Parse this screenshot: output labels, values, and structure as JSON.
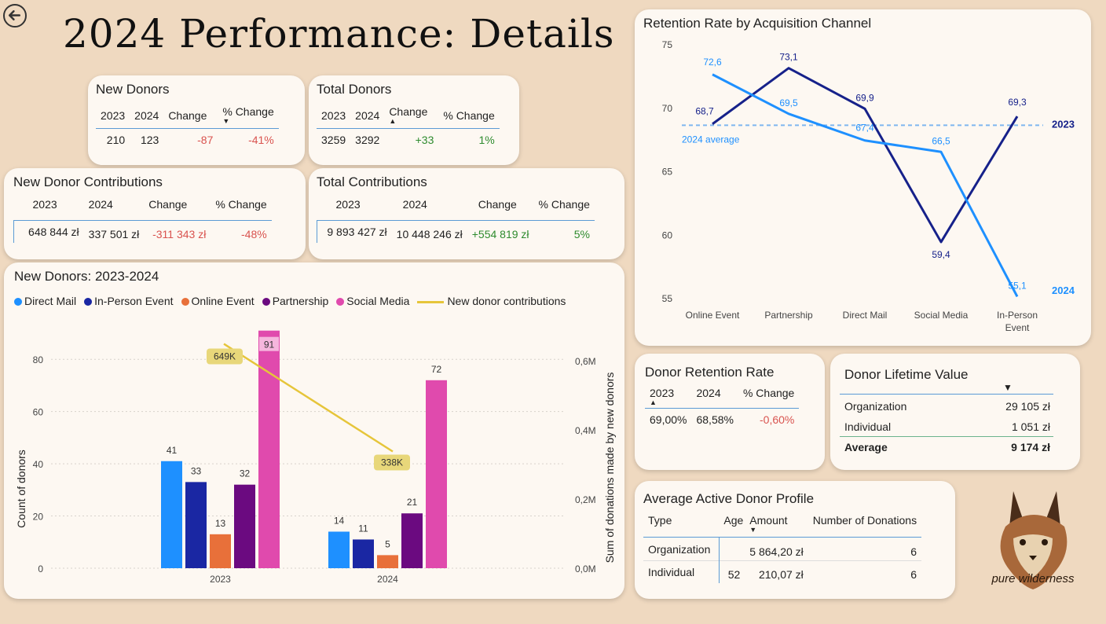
{
  "page": {
    "title": "2024 Performance: Details"
  },
  "new_donors": {
    "title": "New Donors",
    "headers": [
      "2023",
      "2024",
      "Change",
      "% Change"
    ],
    "row": [
      "210",
      "123",
      "-87",
      "-41%"
    ]
  },
  "total_donors": {
    "title": "Total Donors",
    "headers": [
      "2023",
      "2024",
      "Change",
      "% Change"
    ],
    "row": [
      "3259",
      "3292",
      "+33",
      "1%"
    ]
  },
  "new_donor_contrib": {
    "title": "New Donor Contributions",
    "headers": [
      "2023",
      "2024",
      "Change",
      "% Change"
    ],
    "row": [
      "648 844 zł",
      "337 501 zł",
      "-311 343 zł",
      "-48%"
    ]
  },
  "total_contrib": {
    "title": "Total Contributions",
    "headers": [
      "2023",
      "2024",
      "Change",
      "% Change"
    ],
    "row": [
      "9 893 427 zł",
      "10 448 246 zł",
      "+554 819 zł",
      "5%"
    ]
  },
  "bar_chart": {
    "title": "New Donors: 2023-2024",
    "legend": [
      {
        "name": "Direct Mail",
        "color": "#1e90ff"
      },
      {
        "name": "In-Person Event",
        "color": "#1a27a3"
      },
      {
        "name": "Online Event",
        "color": "#e8703a"
      },
      {
        "name": "Partnership",
        "color": "#6b0a80"
      },
      {
        "name": "Social Media",
        "color": "#e04aad"
      },
      {
        "name": "New donor contributions",
        "color": "#e6c53a"
      }
    ],
    "ylabel_left": "Count of donors",
    "ylabel_right": "Sum of donations made by new donors",
    "left_ticks": [
      "0",
      "20",
      "40",
      "60",
      "80"
    ],
    "right_ticks": [
      "0,0M",
      "0,2M",
      "0,4M",
      "0,6M"
    ]
  },
  "line_chart_title": "Retention Rate by Acquisition Channel",
  "line_chart_avg_label": "2024 average",
  "line_chart_ticks": [
    "55",
    "60",
    "65",
    "70",
    "75"
  ],
  "retention": {
    "title": "Donor Retention Rate",
    "headers": [
      "2023",
      "2024",
      "% Change"
    ],
    "row": [
      "69,00%",
      "68,58%",
      "-0,60%"
    ]
  },
  "lifetime": {
    "title": "Donor Lifetime Value",
    "rows": [
      {
        "label": "Organization",
        "value": "29 105 zł"
      },
      {
        "label": "Individual",
        "value": "1 051 zł"
      },
      {
        "label": "Average",
        "value": "9 174 zł"
      }
    ]
  },
  "profile": {
    "title": "Average Active Donor Profile",
    "headers": [
      "Type",
      "Age",
      "Amount",
      "Number of Donations"
    ],
    "rows": [
      [
        "Organization",
        "",
        "5 864,20 zł",
        "6"
      ],
      [
        "Individual",
        "52",
        "210,07 zł",
        "6"
      ]
    ]
  },
  "logo_text": "pure wilderness",
  "chart_data": [
    {
      "type": "bar",
      "title": "New Donors: 2023-2024",
      "categories": [
        "2023",
        "2024"
      ],
      "series": [
        {
          "name": "Direct Mail",
          "values": [
            41,
            14
          ],
          "color": "#1e90ff"
        },
        {
          "name": "In-Person Event",
          "values": [
            33,
            11
          ],
          "color": "#1a27a3"
        },
        {
          "name": "Online Event",
          "values": [
            13,
            5
          ],
          "color": "#e8703a"
        },
        {
          "name": "Partnership",
          "values": [
            32,
            21
          ],
          "color": "#6b0a80"
        },
        {
          "name": "Social Media",
          "values": [
            91,
            72
          ],
          "color": "#e04aad"
        }
      ],
      "line_series": {
        "name": "New donor contributions",
        "values": [
          648844,
          337501
        ],
        "labels": [
          "649K",
          "338K"
        ],
        "color": "#e6c53a"
      },
      "xlabel": "",
      "ylabel": "Count of donors",
      "y2label": "Sum of donations made by new donors",
      "ylim": [
        0,
        90
      ],
      "y2lim": [
        0,
        650000
      ],
      "grid": true,
      "legend": "top-left"
    },
    {
      "type": "line",
      "title": "Retention Rate by Acquisition Channel",
      "categories": [
        "Online Event",
        "Partnership",
        "Direct Mail",
        "Social Media",
        "In-Person Event"
      ],
      "series": [
        {
          "name": "2023",
          "values": [
            68.7,
            73.1,
            69.9,
            59.4,
            69.3
          ],
          "labels": [
            "68,7",
            "73,1",
            "69,9",
            "59,4",
            "69,3"
          ],
          "color": "#16218a"
        },
        {
          "name": "2024",
          "values": [
            72.6,
            69.5,
            67.4,
            66.5,
            55.1
          ],
          "labels": [
            "72,6",
            "69,5",
            "67,4",
            "66,5",
            "55,1"
          ],
          "color": "#1e90ff"
        }
      ],
      "reference_line": {
        "label": "2024 average",
        "value": 68.6
      },
      "ylim": [
        54,
        75
      ],
      "grid": false,
      "legend": "right"
    }
  ]
}
